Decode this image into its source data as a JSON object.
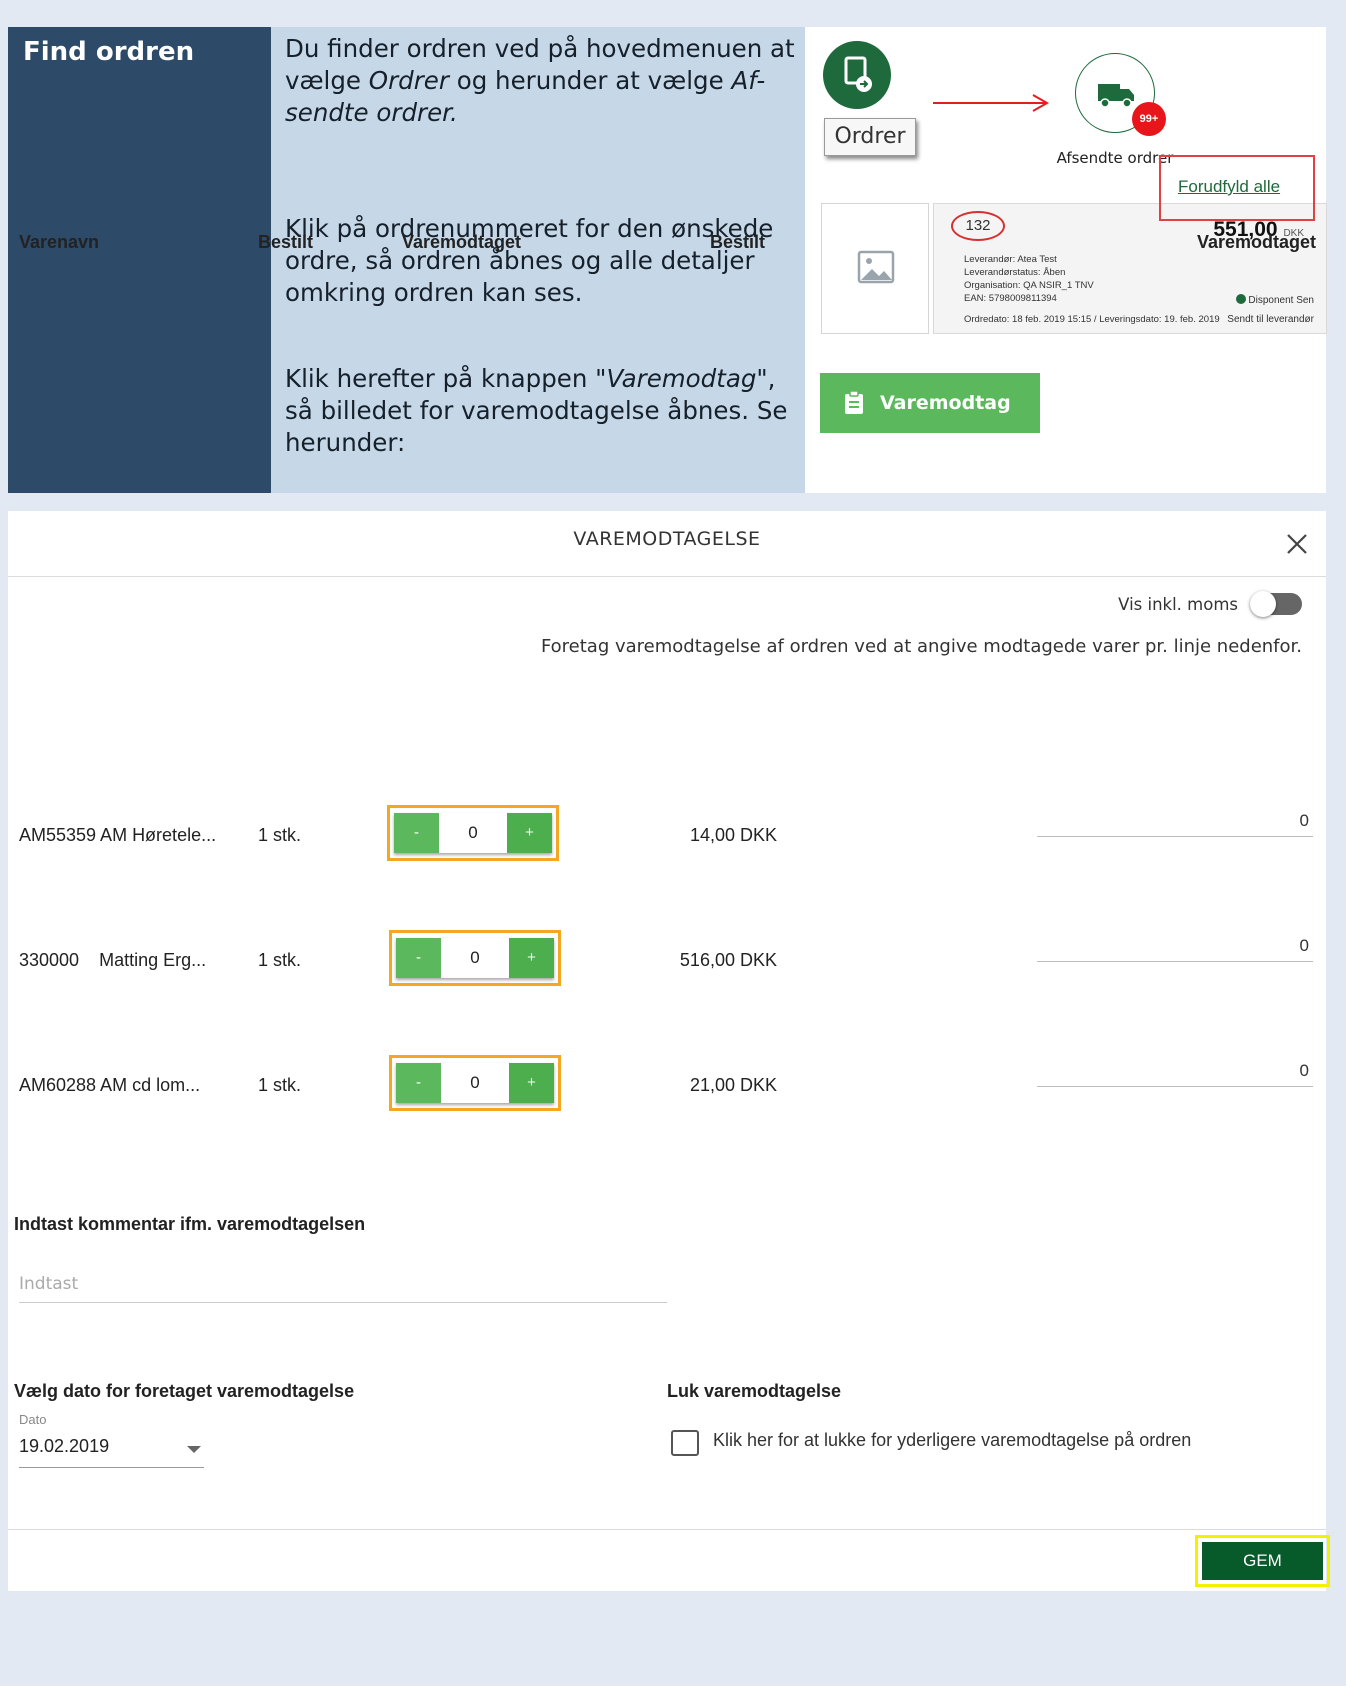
{
  "guide": {
    "title": "Find ordren",
    "step1": {
      "a": "Du finder ordren ved på hovedmenuen at vælge ",
      "i1": "Ordrer",
      "b": " og herunder at vælge ",
      "i2": "Af-sendte ordrer."
    },
    "step2": "Klik på ordrenummeret for den ønskede ordre, så ordren åbnes og alle detaljer omkring ordren kan ses.",
    "step3": {
      "a": "Klik herefter på knappen \"",
      "i": "Varemodtag",
      "b": "\", så billedet for varemodtagelse åbnes. Se herunder:"
    },
    "ordrer_label": "Ordrer",
    "afsendte_label": "Afsendte ordrer",
    "badge": "99+",
    "card": {
      "order_no": "132",
      "amount": "551,00",
      "currency": "DKK",
      "lines": [
        "Leverandør: Atea Test",
        "Leverandørstatus: Åben",
        "Organisation: QA NSIR_1 TNV",
        "EAN: 5798009811394"
      ],
      "dates": "Ordredato: 18 feb. 2019 15:15 / Leveringsdato: 19. feb. 2019",
      "disponent": "Disponent Sen",
      "sendt": "Sendt til leverandør"
    },
    "varemodtag_button": "Varemodtag"
  },
  "modal": {
    "title": "VAREMODTAGELSE",
    "vat_toggle_label": "Vis inkl. moms",
    "intro": "Foretag varemodtagelse af ordren ved at angive modtagede varer pr. linje nedenfor.",
    "prefill_link": "Forudfyld alle",
    "columns": [
      "Varenavn",
      "Bestilt",
      "Varemodtaget",
      "Bestilt",
      "Varemodtaget"
    ],
    "rows": [
      {
        "name": "AM55359 AM Høretele...",
        "qty": "1 stk.",
        "stepper": "0",
        "price": "14,00 DKK",
        "received": "0"
      },
      {
        "name": "330000    Matting Erg...",
        "qty": "1 stk.",
        "stepper": "0",
        "price": "516,00 DKK",
        "received": "0"
      },
      {
        "name": "AM60288 AM cd lom...",
        "qty": "1 stk.",
        "stepper": "0",
        "price": "21,00 DKK",
        "received": "0"
      }
    ],
    "minus": "-",
    "plus": "+",
    "comment_label": "Indtast kommentar ifm. varemodtagelsen",
    "comment_placeholder": "Indtast",
    "date_section_label": "Vælg dato for foretaget varemodtagelse",
    "date_field_label": "Dato",
    "date_value": "19.02.2019",
    "close_section_label": "Luk varemodtagelse",
    "close_checkbox_label": "Klik her for at lukke for yderligere varemodtagelse på ordren",
    "save_button": "GEM"
  },
  "colors": {
    "brand_green": "#1e6a3c",
    "button_green": "#5cb85c",
    "dark_green": "#075a2a",
    "highlight_orange": "#f5a623",
    "highlight_red": "#e04141",
    "highlight_yellow": "#f2f200"
  }
}
